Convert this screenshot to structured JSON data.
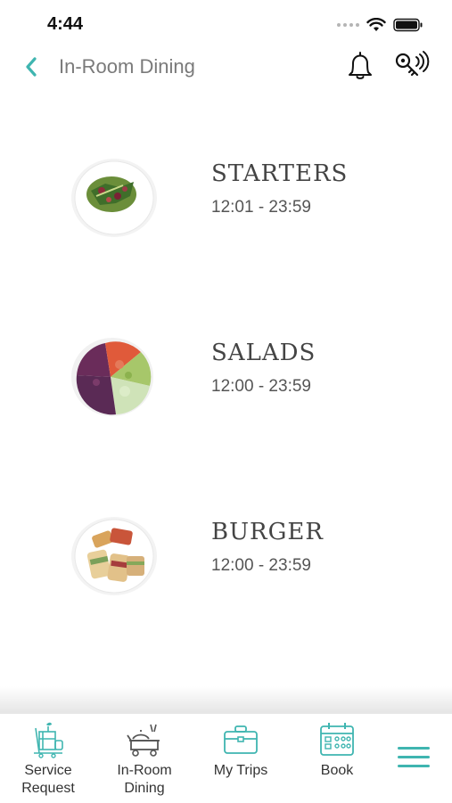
{
  "status_bar": {
    "time": "4:44"
  },
  "header": {
    "title": "In-Room Dining",
    "back_icon": "chevron-left-icon",
    "notifications_icon": "bell-icon",
    "key_icon": "digital-key-icon"
  },
  "menu": {
    "items": [
      {
        "name": "STARTERS",
        "hours": "12:01 - 23:59",
        "image": "starter-salad-plate"
      },
      {
        "name": "SALADS",
        "hours": "12:00 - 23:59",
        "image": "salad-bowl"
      },
      {
        "name": "BURGER",
        "hours": "12:00 - 23:59",
        "image": "burger-sandwich-plate"
      }
    ]
  },
  "tab_bar": {
    "tabs": [
      {
        "label": "Service\nRequest",
        "icon": "cleaning-cart-icon"
      },
      {
        "label": "In-Room\nDining",
        "icon": "room-service-trolley-icon"
      },
      {
        "label": "My Trips",
        "icon": "briefcase-icon"
      },
      {
        "label": "Book",
        "icon": "calendar-icon"
      }
    ],
    "menu_icon": "hamburger-menu-icon"
  },
  "colors": {
    "accent": "#3fb5b0",
    "title_gray": "#7a7a7a"
  }
}
